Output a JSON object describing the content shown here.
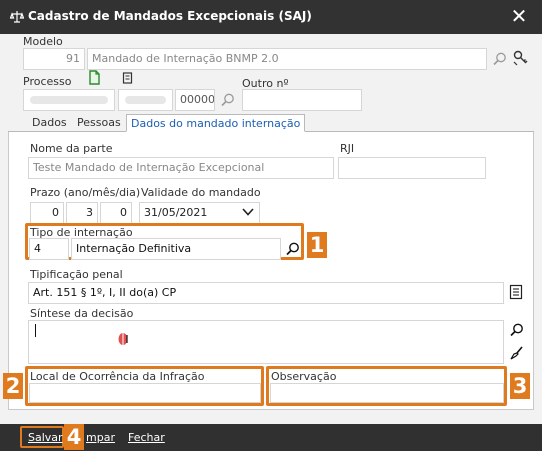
{
  "window": {
    "title": "Cadastro de Mandados Excepcionais (SAJ)",
    "close_glyph": "✕"
  },
  "modelo": {
    "label": "Modelo",
    "code": "91",
    "description": "Mandado de Internação BNMP 2.0"
  },
  "processo": {
    "label": "Processo",
    "number_suffix": "00000",
    "outro_label": "Outro nº",
    "outro_value": ""
  },
  "tabs": [
    {
      "label": "Dados",
      "active": false
    },
    {
      "label": "Pessoas",
      "active": false
    },
    {
      "label": "Dados do mandado internação",
      "active": true
    }
  ],
  "form": {
    "nome_parte_label": "Nome da parte",
    "nome_parte_value": "Teste Mandado de Internação Excepcional",
    "rji_label": "RJI",
    "rji_value": "",
    "prazo_label": "Prazo (ano/mês/dia)",
    "prazo_ano": "0",
    "prazo_mes": "3",
    "prazo_dia": "0",
    "validade_label": "Validade do mandado",
    "validade_value": "31/05/2021",
    "tipo_label": "Tipo de internação",
    "tipo_code": "4",
    "tipo_value": "Internação Definitiva",
    "tipificacao_label": "Tipificação penal",
    "tipificacao_value": "Art. 151 § 1º, I, II do(a) CP",
    "sintese_label": "Síntese da decisão",
    "sintese_value": "",
    "local_label": "Local de Ocorrência da Infração",
    "local_value": "",
    "observacao_label": "Observação",
    "observacao_value": ""
  },
  "buttons": {
    "salvar": "Salvar",
    "limpar": "mpar",
    "fechar": "Fechar"
  },
  "callouts": [
    "1",
    "2",
    "3",
    "4"
  ],
  "colors": {
    "titlebar": "#323232",
    "highlight": "#e07a1f",
    "active_tab_text": "#1c5fb3",
    "bottombar": "#303030"
  },
  "icons": {
    "title": "scale-justice-icon",
    "search": "magnifier-icon",
    "key": "key-settings-icon",
    "process_doc": "green-document-icon",
    "process_attach": "document-small-icon",
    "list": "list-document-icon",
    "brush": "brush-clear-icon"
  }
}
